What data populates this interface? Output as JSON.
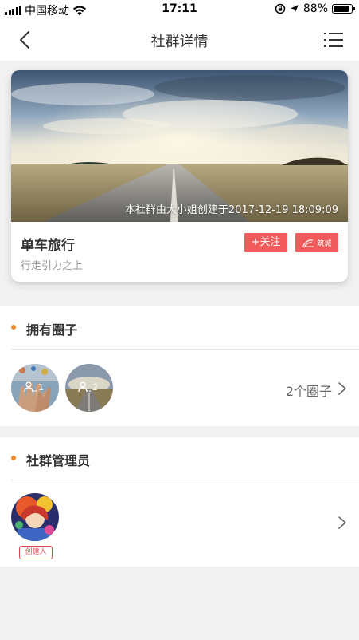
{
  "status_bar": {
    "carrier": "中国移动",
    "time": "17:11",
    "battery_percent": "88%",
    "battery_level": 0.88
  },
  "navbar": {
    "title": "社群详情"
  },
  "community": {
    "created_text": "本社群由大小姐创建于2017-12-19 18:09:09",
    "name": "单车旅行",
    "description": "行走引力之上",
    "follow_label": "+关注",
    "brand_label": "筑城"
  },
  "circles_section": {
    "title": "拥有圈子",
    "circles": [
      {
        "member_count": "1"
      },
      {
        "member_count": "2"
      }
    ],
    "count_text": "2个圈子"
  },
  "admins_section": {
    "title": "社群管理员",
    "creator_tag": "创建人"
  },
  "colors": {
    "accent_red": "#f05a5a",
    "section_dot": "#f08a2a",
    "background": "#f2f2f2"
  },
  "icons": [
    "signal-icon",
    "wifi-icon",
    "rotation-lock-icon",
    "location-arrow-icon",
    "battery-icon",
    "back-icon",
    "menu-icon",
    "chevron-right-icon",
    "members-icon"
  ]
}
